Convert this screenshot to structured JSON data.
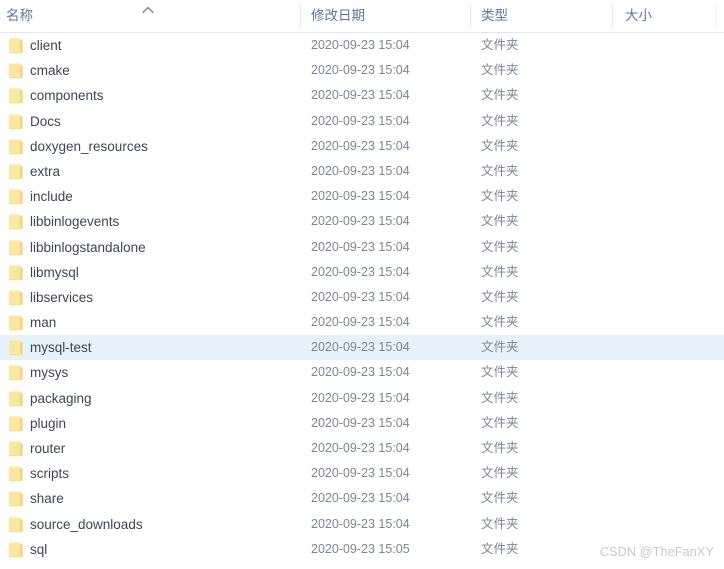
{
  "header": {
    "columns": [
      {
        "key": "name",
        "label": "名称",
        "sorted": true,
        "sort_direction": "ascending"
      },
      {
        "key": "date",
        "label": "修改日期",
        "sorted": false,
        "sort_direction": ""
      },
      {
        "key": "type",
        "label": "类型",
        "sorted": false,
        "sort_direction": ""
      },
      {
        "key": "size",
        "label": "大小",
        "sorted": false,
        "sort_direction": ""
      }
    ],
    "sort_icon": "chevron-up-icon"
  },
  "colors": {
    "header_text": "#5a7a9c",
    "row_text": "#3d4655",
    "meta_text": "#7b8694",
    "selection": "#e5f1fb",
    "folder_fill": "#fbe6a2",
    "folder_edge": "#f3d37e",
    "divider": "#e4e8ec",
    "watermark": "#c6c8cb",
    "background": "#ffffff"
  },
  "rows": [
    {
      "icon": "folder-icon",
      "name": "client",
      "date": "2020-09-23 15:04",
      "type": "文件夹",
      "size": "",
      "selected": false
    },
    {
      "icon": "folder-icon",
      "name": "cmake",
      "date": "2020-09-23 15:04",
      "type": "文件夹",
      "size": "",
      "selected": false
    },
    {
      "icon": "folder-icon",
      "name": "components",
      "date": "2020-09-23 15:04",
      "type": "文件夹",
      "size": "",
      "selected": false
    },
    {
      "icon": "folder-icon",
      "name": "Docs",
      "date": "2020-09-23 15:04",
      "type": "文件夹",
      "size": "",
      "selected": false
    },
    {
      "icon": "folder-icon",
      "name": "doxygen_resources",
      "date": "2020-09-23 15:04",
      "type": "文件夹",
      "size": "",
      "selected": false
    },
    {
      "icon": "folder-icon",
      "name": "extra",
      "date": "2020-09-23 15:04",
      "type": "文件夹",
      "size": "",
      "selected": false
    },
    {
      "icon": "folder-icon",
      "name": "include",
      "date": "2020-09-23 15:04",
      "type": "文件夹",
      "size": "",
      "selected": false
    },
    {
      "icon": "folder-icon",
      "name": "libbinlogevents",
      "date": "2020-09-23 15:04",
      "type": "文件夹",
      "size": "",
      "selected": false
    },
    {
      "icon": "folder-icon",
      "name": "libbinlogstandalone",
      "date": "2020-09-23 15:04",
      "type": "文件夹",
      "size": "",
      "selected": false
    },
    {
      "icon": "folder-icon",
      "name": "libmysql",
      "date": "2020-09-23 15:04",
      "type": "文件夹",
      "size": "",
      "selected": false
    },
    {
      "icon": "folder-icon",
      "name": "libservices",
      "date": "2020-09-23 15:04",
      "type": "文件夹",
      "size": "",
      "selected": false
    },
    {
      "icon": "folder-icon",
      "name": "man",
      "date": "2020-09-23 15:04",
      "type": "文件夹",
      "size": "",
      "selected": false
    },
    {
      "icon": "folder-icon",
      "name": "mysql-test",
      "date": "2020-09-23 15:04",
      "type": "文件夹",
      "size": "",
      "selected": true
    },
    {
      "icon": "folder-icon",
      "name": "mysys",
      "date": "2020-09-23 15:04",
      "type": "文件夹",
      "size": "",
      "selected": false
    },
    {
      "icon": "folder-icon",
      "name": "packaging",
      "date": "2020-09-23 15:04",
      "type": "文件夹",
      "size": "",
      "selected": false
    },
    {
      "icon": "folder-icon",
      "name": "plugin",
      "date": "2020-09-23 15:04",
      "type": "文件夹",
      "size": "",
      "selected": false
    },
    {
      "icon": "folder-icon",
      "name": "router",
      "date": "2020-09-23 15:04",
      "type": "文件夹",
      "size": "",
      "selected": false
    },
    {
      "icon": "folder-icon",
      "name": "scripts",
      "date": "2020-09-23 15:04",
      "type": "文件夹",
      "size": "",
      "selected": false
    },
    {
      "icon": "folder-icon",
      "name": "share",
      "date": "2020-09-23 15:04",
      "type": "文件夹",
      "size": "",
      "selected": false
    },
    {
      "icon": "folder-icon",
      "name": "source_downloads",
      "date": "2020-09-23 15:04",
      "type": "文件夹",
      "size": "",
      "selected": false
    },
    {
      "icon": "folder-icon",
      "name": "sql",
      "date": "2020-09-23 15:05",
      "type": "文件夹",
      "size": "",
      "selected": false
    }
  ],
  "watermark": {
    "text": "CSDN @TheFanXY"
  }
}
